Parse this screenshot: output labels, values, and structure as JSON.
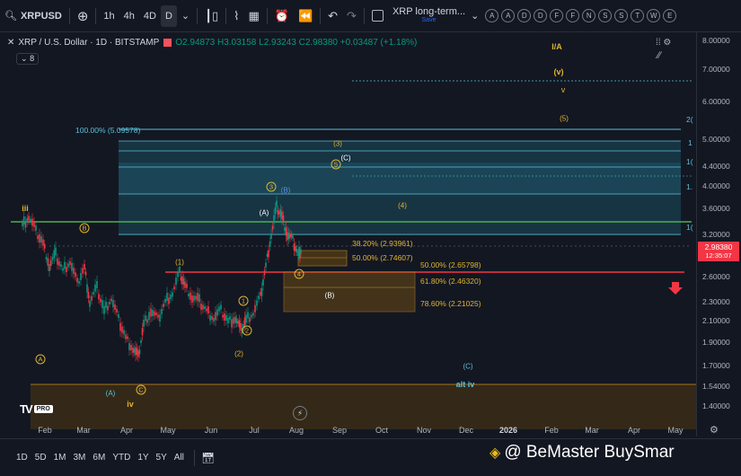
{
  "topbar": {
    "symbol": "XRPUSD",
    "intervals": [
      "1h",
      "4h",
      "4D",
      "D"
    ],
    "active_interval": "D",
    "layout_name": "XRP long-term...",
    "layout_sub": "Save",
    "circles": [
      "A",
      "A",
      "D",
      "D",
      "F",
      "F",
      "N",
      "S",
      "S",
      "T",
      "W",
      "E"
    ]
  },
  "legend": {
    "title": "XRP / U.S. Dollar · 1D · BITSTAMP",
    "ohlc": "O2.94873 H3.03158 L2.93243 C2.98380 +0.03487 (+1.18%)",
    "indicators_count": "8"
  },
  "axis": {
    "labels": [
      "8.00000",
      "7.00000",
      "6.00000",
      "5.00000",
      "4.40000",
      "4.00000",
      "3.60000",
      "3.20000",
      "2.60000",
      "2.30000",
      "2.10000",
      "1.90000",
      "1.70000",
      "1.54000",
      "1.40000"
    ],
    "current_price": "2.98380",
    "countdown": "12:35:07"
  },
  "x_labels": [
    "Feb",
    "Mar",
    "Apr",
    "May",
    "Jun",
    "Jul",
    "Aug",
    "Sep",
    "Oct",
    "Nov",
    "Dec",
    "2026",
    "Feb",
    "Mar",
    "Apr",
    "May"
  ],
  "fib": {
    "top": "100.00% (5.09578)",
    "l1": "38.20% (2.93961)",
    "l2": "50.00% (2.74607)",
    "r1": "50.00% (2.65798)",
    "r2": "61.80% (2.46320)",
    "r3": "78.60% (2.21025)"
  },
  "waves": {
    "iii": "iii",
    "iv": "iv",
    "alt_iv": "alt iv",
    "IA": "I/A",
    "v_big": "(v)",
    "v_small": "v",
    "w5": "(5)",
    "w3": "(3)",
    "w4": "(4)",
    "wC_top": "(C)",
    "wA": "(A)",
    "wB_top": "(B)",
    "wB_box": "(B)",
    "w1": "(1)",
    "w2": "(2)",
    "wC_bottom": "(C)",
    "wA_bottom": "(A)",
    "c1": "1",
    "c2": "2",
    "c3": "3",
    "c4": "4",
    "c5": "5",
    "cA": "A",
    "cB": "B",
    "cC": "C"
  },
  "right_edge": [
    "2(",
    "1",
    "1(",
    "1.",
    "1("
  ],
  "bottombar": {
    "ranges": [
      "1D",
      "5D",
      "1M",
      "3M",
      "6M",
      "YTD",
      "1Y",
      "5Y",
      "All"
    ],
    "watermark": "@ BeMaster BuySmar"
  },
  "logo": "PRO",
  "colors": {
    "up": "#089981",
    "down": "#f23645",
    "gold": "#e0b430",
    "green": "#4caf50",
    "teal": "#1c6e7f"
  }
}
